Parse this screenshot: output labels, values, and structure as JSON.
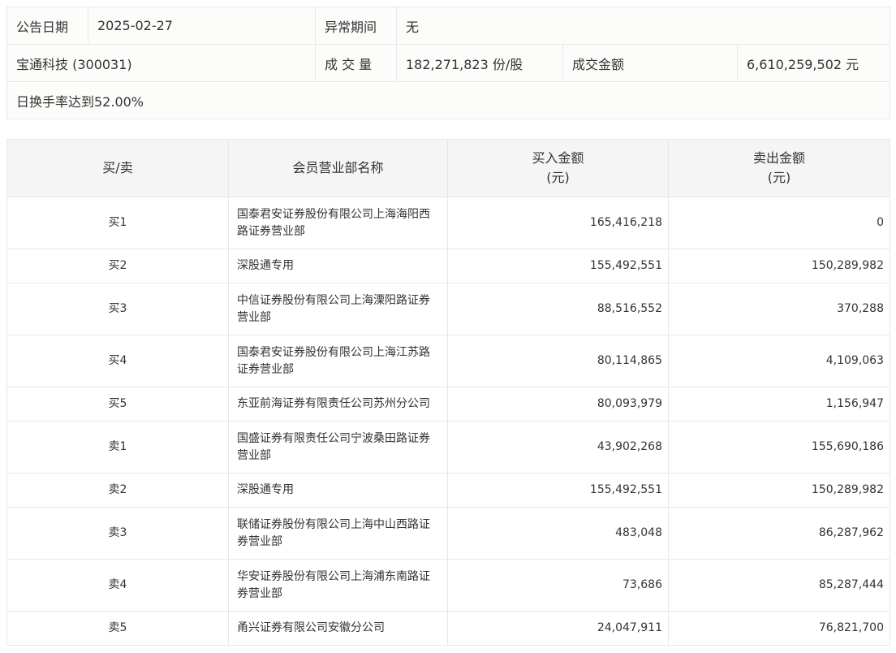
{
  "info": {
    "date_label": "公告日期",
    "date_value": "2025-02-27",
    "abnormal_label": "异常期间",
    "abnormal_value": "无",
    "stock": "宝通科技 (300031)",
    "volume_label": "成 交 量",
    "volume_value": "182,271,823 份/股",
    "amount_label": "成交金额",
    "amount_value": "6,610,259,502 元",
    "reason": "日换手率达到52.00%"
  },
  "table": {
    "headers": {
      "side": "买/卖",
      "broker": "会员营业部名称",
      "buy": "买入金额",
      "buy_unit": "(元)",
      "sell": "卖出金额",
      "sell_unit": "(元)"
    },
    "rows": [
      {
        "side": "买1",
        "broker": "国泰君安证券股份有限公司上海海阳西路证券营业部",
        "buy": "165,416,218",
        "sell": "0"
      },
      {
        "side": "买2",
        "broker": "深股通专用",
        "buy": "155,492,551",
        "sell": "150,289,982"
      },
      {
        "side": "买3",
        "broker": "中信证券股份有限公司上海溧阳路证券营业部",
        "buy": "88,516,552",
        "sell": "370,288"
      },
      {
        "side": "买4",
        "broker": "国泰君安证券股份有限公司上海江苏路证券营业部",
        "buy": "80,114,865",
        "sell": "4,109,063"
      },
      {
        "side": "买5",
        "broker": "东亚前海证券有限责任公司苏州分公司",
        "buy": "80,093,979",
        "sell": "1,156,947"
      },
      {
        "side": "卖1",
        "broker": "国盛证券有限责任公司宁波桑田路证券营业部",
        "buy": "43,902,268",
        "sell": "155,690,186"
      },
      {
        "side": "卖2",
        "broker": "深股通专用",
        "buy": "155,492,551",
        "sell": "150,289,982"
      },
      {
        "side": "卖3",
        "broker": "联储证券股份有限公司上海中山西路证券营业部",
        "buy": "483,048",
        "sell": "86,287,962"
      },
      {
        "side": "卖4",
        "broker": "华安证券股份有限公司上海浦东南路证券营业部",
        "buy": "73,686",
        "sell": "85,287,444"
      },
      {
        "side": "卖5",
        "broker": "甬兴证券有限公司安徽分公司",
        "buy": "24,047,911",
        "sell": "76,821,700"
      }
    ]
  }
}
